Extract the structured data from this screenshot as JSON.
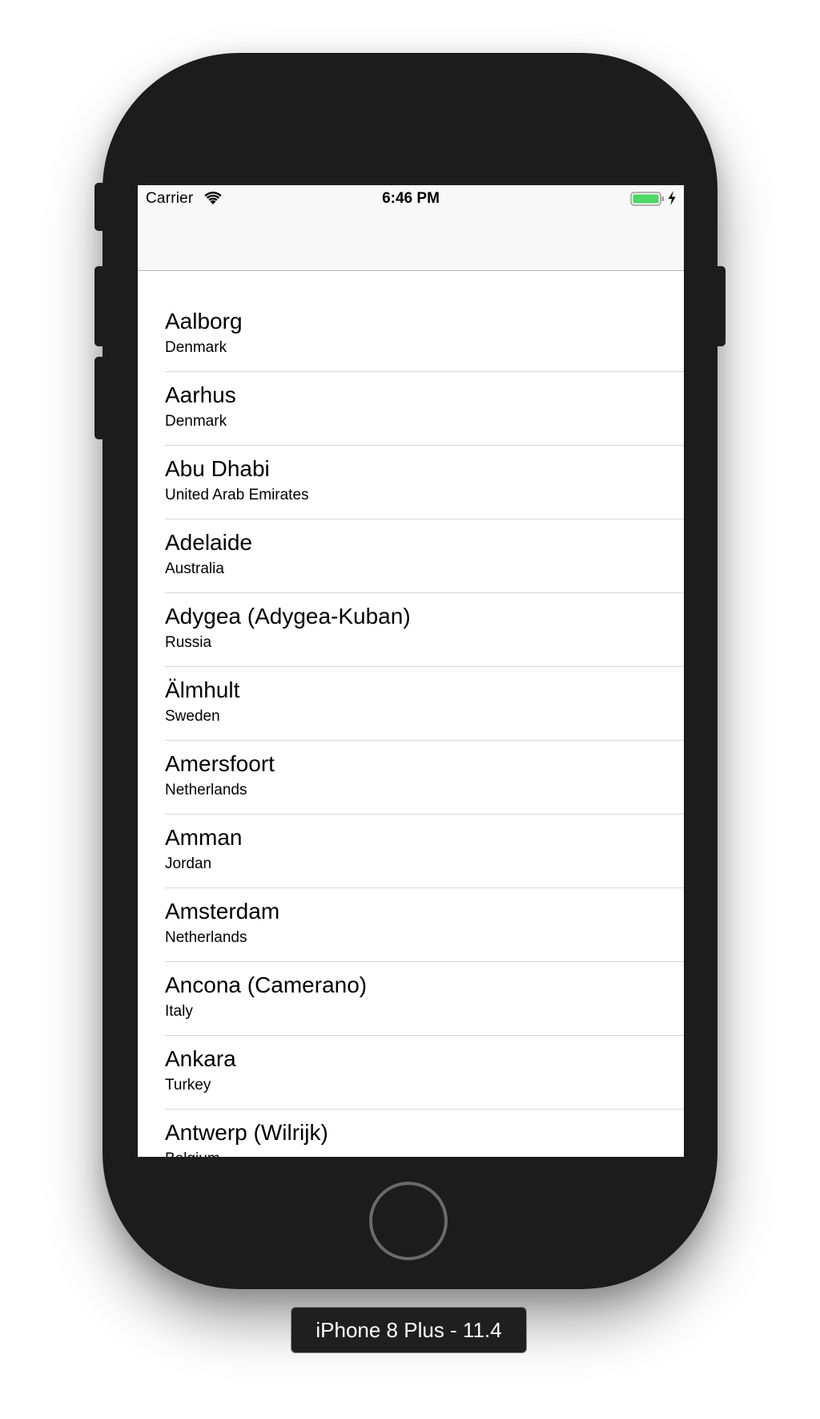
{
  "status_bar": {
    "carrier": "Carrier",
    "time": "6:46 PM",
    "icons": [
      "wifi-icon",
      "battery-icon",
      "charging-icon"
    ],
    "battery_color": "#4cd964"
  },
  "cities": [
    {
      "city": "Aalborg",
      "country": "Denmark"
    },
    {
      "city": "Aarhus",
      "country": "Denmark"
    },
    {
      "city": "Abu Dhabi",
      "country": "United Arab Emirates"
    },
    {
      "city": "Adelaide",
      "country": "Australia"
    },
    {
      "city": "Adygea (Adygea-Kuban)",
      "country": "Russia"
    },
    {
      "city": "Älmhult",
      "country": "Sweden"
    },
    {
      "city": "Amersfoort",
      "country": "Netherlands"
    },
    {
      "city": "Amman",
      "country": "Jordan"
    },
    {
      "city": "Amsterdam",
      "country": "Netherlands"
    },
    {
      "city": "Ancona (Camerano)",
      "country": "Italy"
    },
    {
      "city": "Ankara",
      "country": "Turkey"
    },
    {
      "city": "Antwerp (Wilrijk)",
      "country": "Belgium"
    }
  ],
  "device_label": "iPhone 8 Plus - 11.4"
}
